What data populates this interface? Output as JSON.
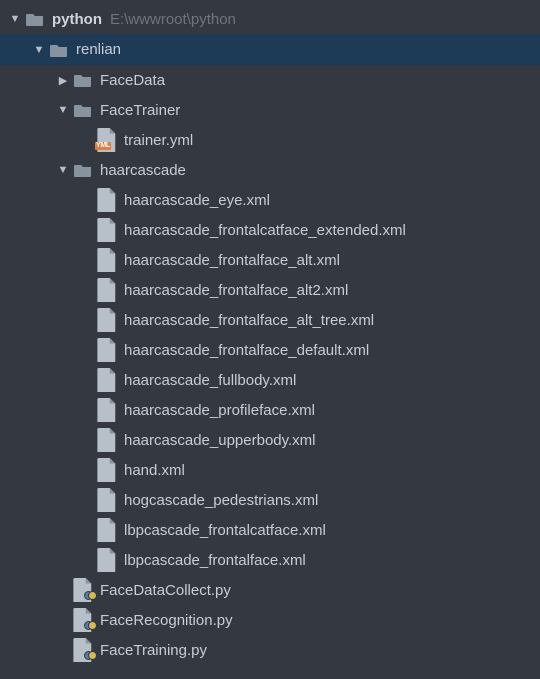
{
  "tree": {
    "root": {
      "name": "python",
      "path": "E:\\wwwroot\\python",
      "expanded": true
    },
    "renlian": {
      "name": "renlian",
      "expanded": true
    },
    "facedata": {
      "name": "FaceData",
      "expanded": false
    },
    "facetrainer": {
      "name": "FaceTrainer",
      "expanded": true
    },
    "trainer_yml": {
      "name": "trainer.yml"
    },
    "haarcascade": {
      "name": "haarcascade",
      "expanded": true
    },
    "xml_files": [
      "haarcascade_eye.xml",
      "haarcascade_frontalcatface_extended.xml",
      "haarcascade_frontalface_alt.xml",
      "haarcascade_frontalface_alt2.xml",
      "haarcascade_frontalface_alt_tree.xml",
      "haarcascade_frontalface_default.xml",
      "haarcascade_fullbody.xml",
      "haarcascade_profileface.xml",
      "haarcascade_upperbody.xml",
      "hand.xml",
      "hogcascade_pedestrians.xml",
      "lbpcascade_frontalcatface.xml",
      "lbpcascade_frontalface.xml"
    ],
    "py_files": [
      "FaceDataCollect.py",
      "FaceRecognition.py",
      "FaceTraining.py"
    ]
  },
  "icons": {
    "yml_badge": "YML",
    "xml_badge": "</>"
  }
}
